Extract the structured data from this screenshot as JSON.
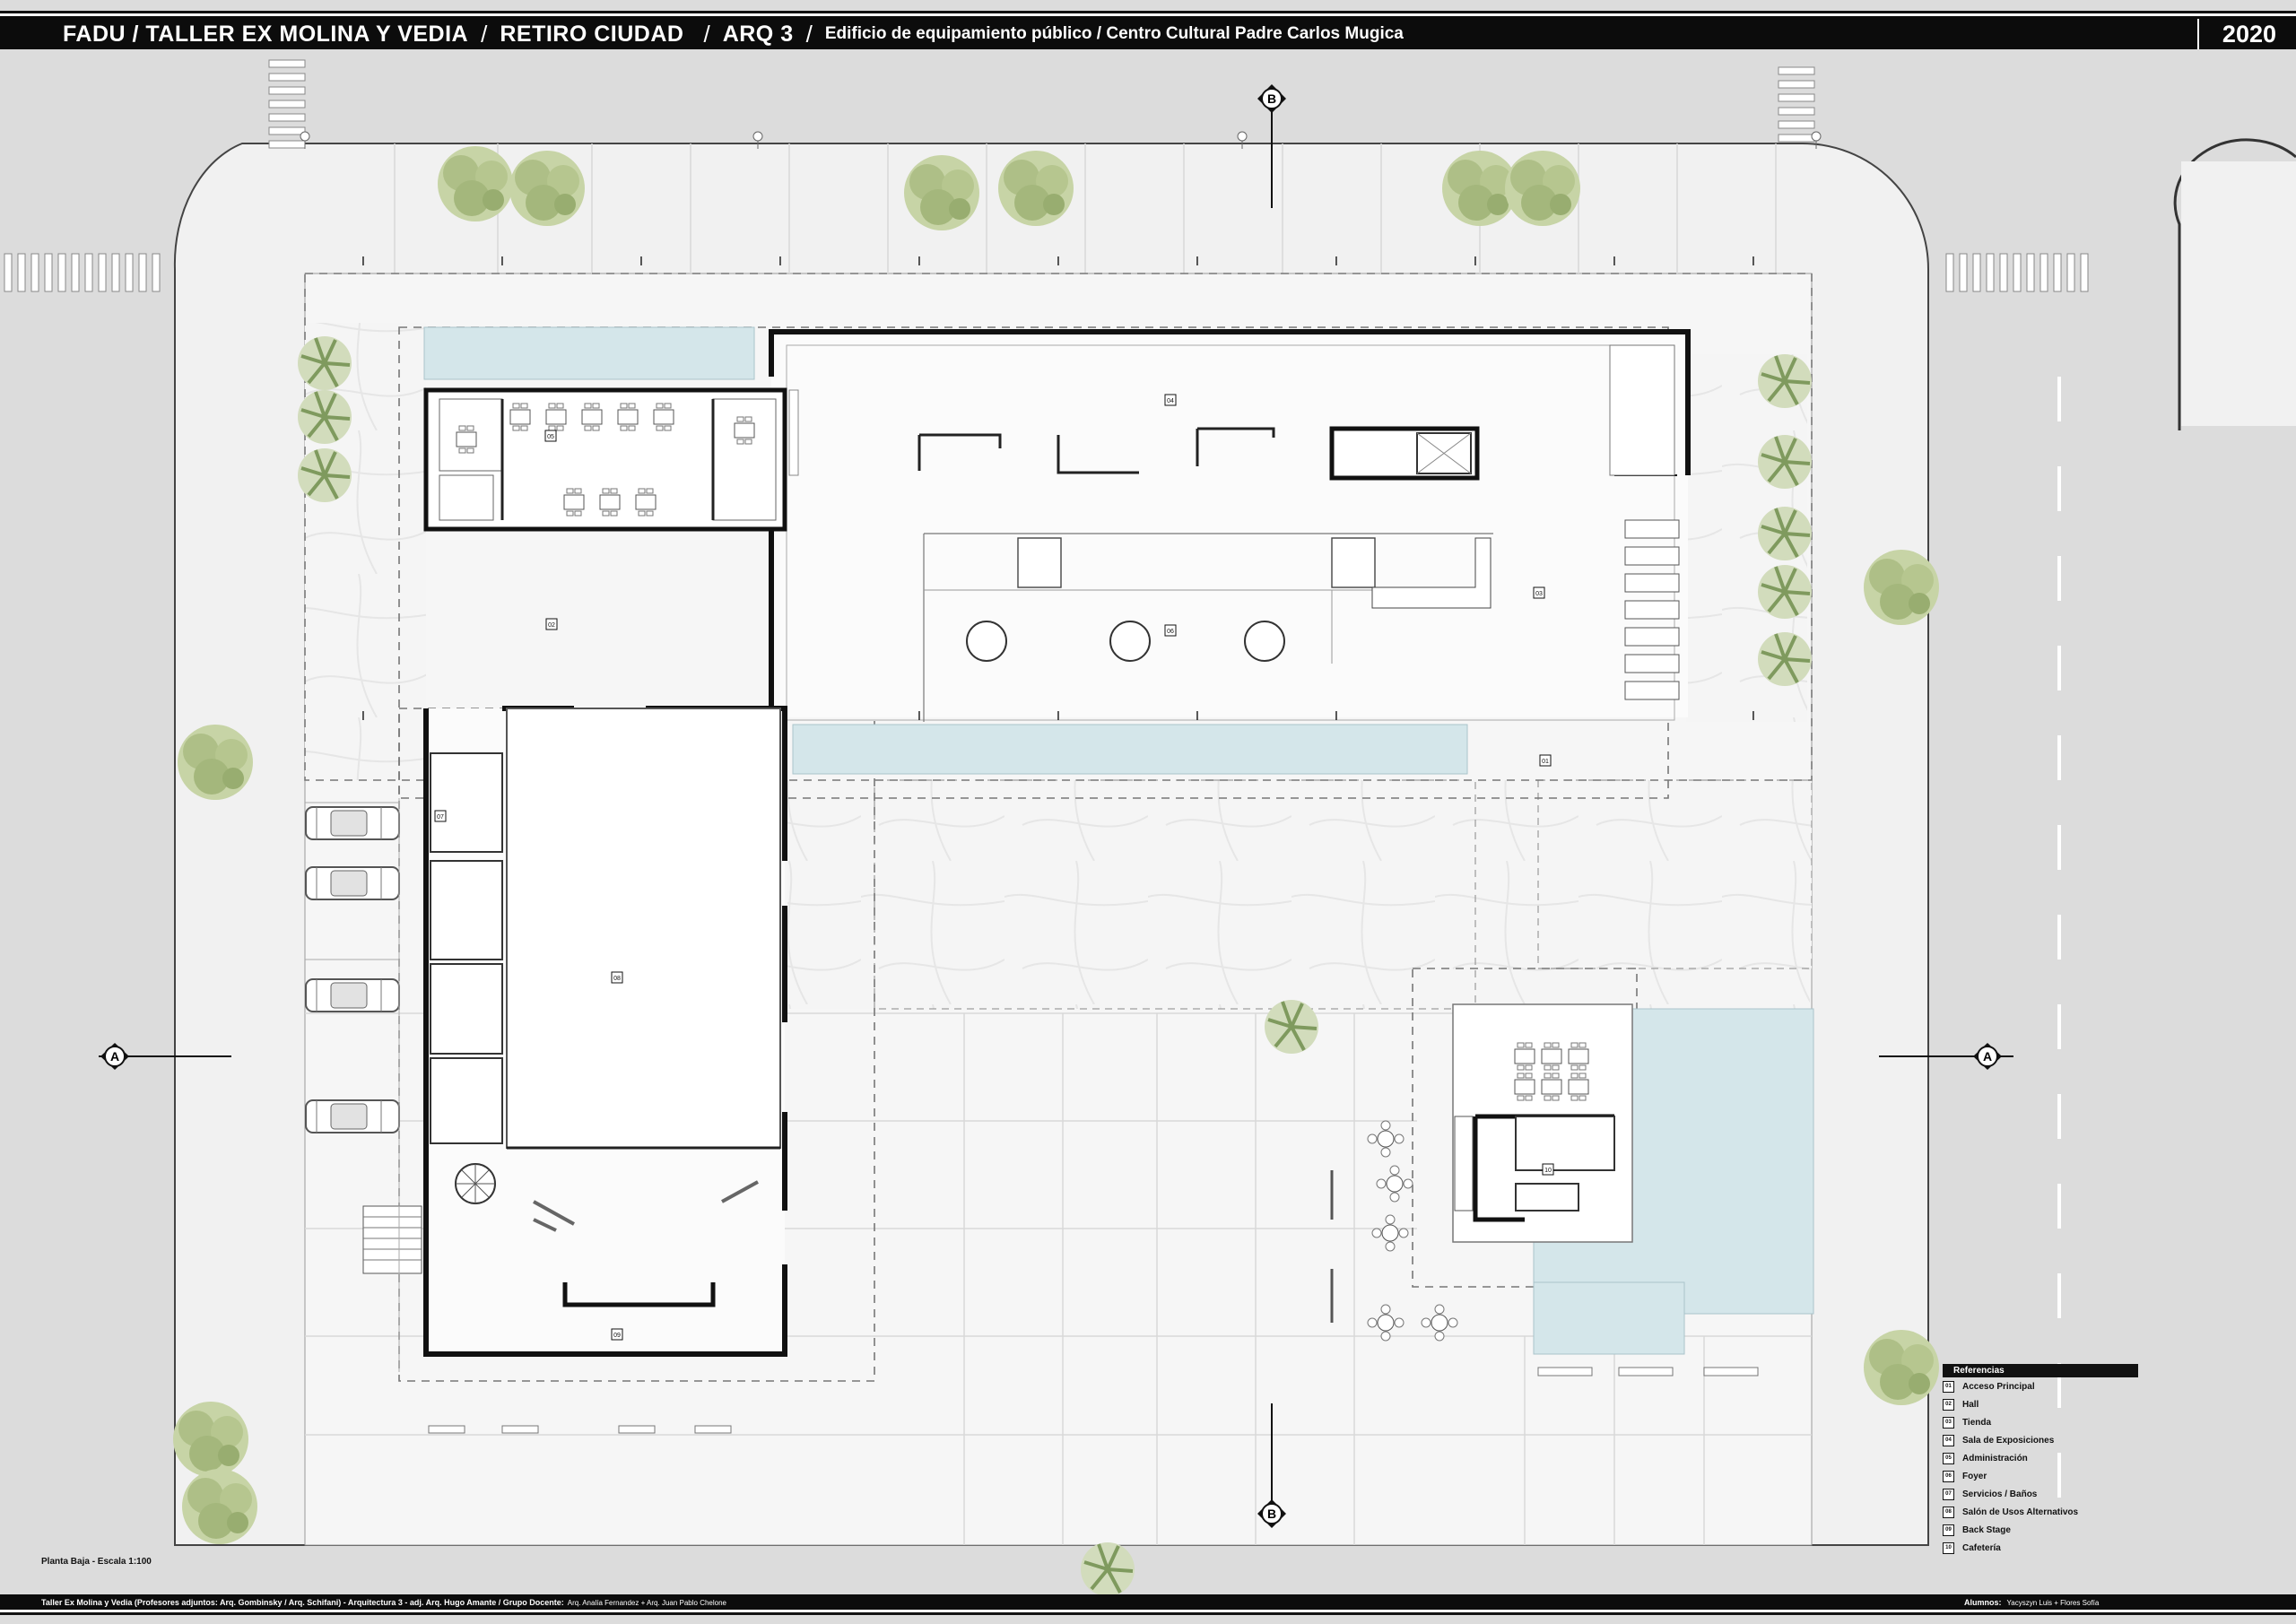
{
  "header": {
    "school": "FADU / TALLER EX MOLINA Y VEDIA",
    "site": "RETIRO CIUDAD",
    "course": "ARQ 3",
    "project": "Edificio de equipamiento público / Centro Cultural Padre Carlos Mugica",
    "year": "2020"
  },
  "plan": {
    "scale_label": "Planta Baja - Escala 1:100",
    "section_marks": [
      "A",
      "A",
      "B",
      "B"
    ],
    "room_tags": [
      "01",
      "02",
      "03",
      "04",
      "05",
      "06",
      "07",
      "08",
      "09",
      "10"
    ]
  },
  "legend": {
    "title": "Referencias",
    "items": [
      {
        "num": "01",
        "label": "Acceso Principal"
      },
      {
        "num": "02",
        "label": "Hall"
      },
      {
        "num": "03",
        "label": "Tienda"
      },
      {
        "num": "04",
        "label": "Sala de Exposiciones"
      },
      {
        "num": "05",
        "label": "Administración"
      },
      {
        "num": "06",
        "label": "Foyer"
      },
      {
        "num": "07",
        "label": "Servicios / Baños"
      },
      {
        "num": "08",
        "label": "Salón de Usos Alternativos"
      },
      {
        "num": "09",
        "label": "Back Stage"
      },
      {
        "num": "10",
        "label": "Cafetería"
      }
    ]
  },
  "footer": {
    "credits": "Taller Ex Molina y Vedia (Profesores adjuntos: Arq. Gombinsky / Arq. Schifani) - Arquitectura 3 - adj. Arq. Hugo Amante / Grupo Docente:",
    "docentes": "Arq. Analía Fernandez + Arq. Juan Pablo Chelone",
    "students_label": "Alumnos:",
    "students": "Yacyszyn Luis + Flores Sofía"
  },
  "colors": {
    "street": "#dcdcdc",
    "sidewalk": "#f3f3f3",
    "plaza": "#f7f7f7",
    "water": "#cfe1e5",
    "wall": "#111111",
    "tree": "#b9c99a"
  }
}
